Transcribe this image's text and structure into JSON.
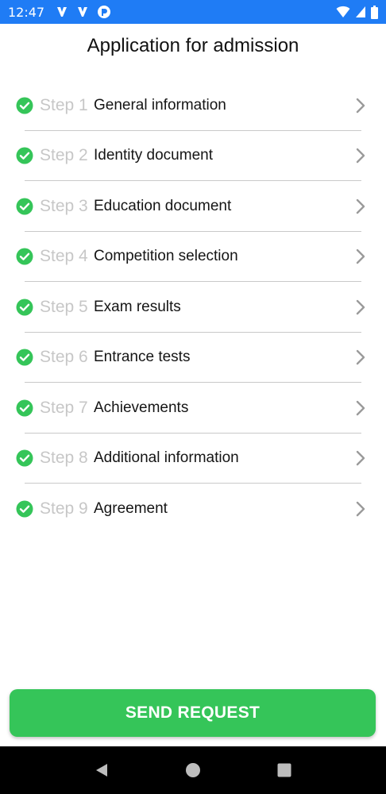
{
  "status_bar": {
    "time": "12:47",
    "left_icons": [
      "app-notification-icon",
      "app-notification-icon",
      "app-badge-icon"
    ],
    "right_icons": [
      "wifi-icon",
      "signal-icon",
      "battery-icon"
    ]
  },
  "header": {
    "title": "Application for admission"
  },
  "steps": [
    {
      "number": "Step 1",
      "label": "General information"
    },
    {
      "number": "Step 2",
      "label": "Identity document"
    },
    {
      "number": "Step 3",
      "label": "Education document"
    },
    {
      "number": "Step 4",
      "label": "Competition selection"
    },
    {
      "number": "Step 5",
      "label": "Exam results"
    },
    {
      "number": "Step 6",
      "label": "Entrance tests"
    },
    {
      "number": "Step 7",
      "label": "Achievements"
    },
    {
      "number": "Step 8",
      "label": "Additional information"
    },
    {
      "number": "Step 9",
      "label": "Agreement"
    }
  ],
  "actions": {
    "send_label": "SEND REQUEST"
  },
  "colors": {
    "status_bar": "#1f7cf5",
    "accent_green": "#35c559",
    "step_number_gray": "#c7c7c7"
  }
}
